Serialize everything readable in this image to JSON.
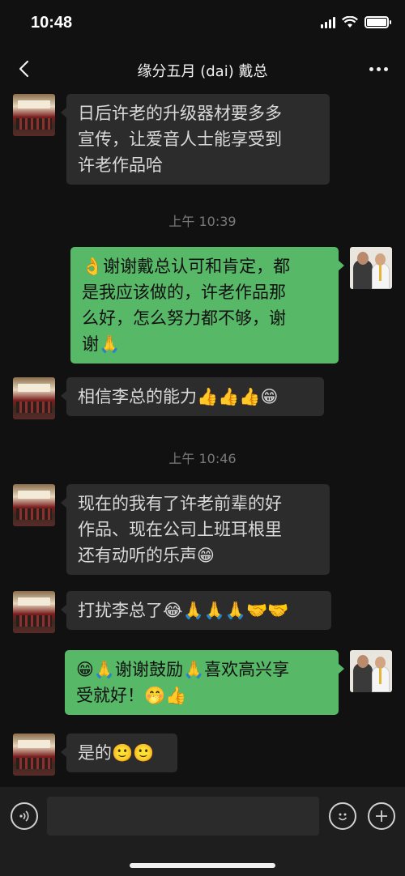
{
  "status_bar": {
    "time": "10:48",
    "battery_percent": 100
  },
  "header": {
    "title": "缘分五月 (dai) 戴总"
  },
  "messages": [
    {
      "side": "left",
      "avatar": "room-photo-avatar",
      "text": "日后许老的升级器材要多多\n宣传，让爱音人士能享受到\n许老作品哈"
    },
    {
      "timestamp": "上午 10:39"
    },
    {
      "side": "right",
      "avatar": "two-men-avatar",
      "text": "👌谢谢戴总认可和肯定，都\n是我应该做的，许老作品那\n么好，怎么努力都不够，谢\n谢🙏"
    },
    {
      "side": "left",
      "avatar": "room-photo-avatar",
      "text": "相信李总的能力👍👍👍😁"
    },
    {
      "timestamp": "上午 10:46"
    },
    {
      "side": "left",
      "avatar": "room-photo-avatar",
      "text": "现在的我有了许老前辈的好\n作品、现在公司上班耳根里\n还有动听的乐声😁"
    },
    {
      "side": "left",
      "avatar": "room-photo-avatar",
      "text": "打扰李总了😂🙏🙏🙏🤝🤝"
    },
    {
      "side": "right",
      "avatar": "two-men-avatar",
      "text": "😁🙏谢谢鼓励🙏喜欢高兴享\n受就好！🤭👍"
    },
    {
      "side": "left",
      "avatar": "room-photo-avatar",
      "text": "是的🙂🙂"
    }
  ],
  "input_bar": {
    "voice_icon": "voice-icon",
    "emoji_icon": "emoji-icon",
    "plus_icon": "plus-icon"
  },
  "colors": {
    "background": "#111111",
    "bubble_left": "#2c2c2c",
    "bubble_right": "#57b868"
  }
}
